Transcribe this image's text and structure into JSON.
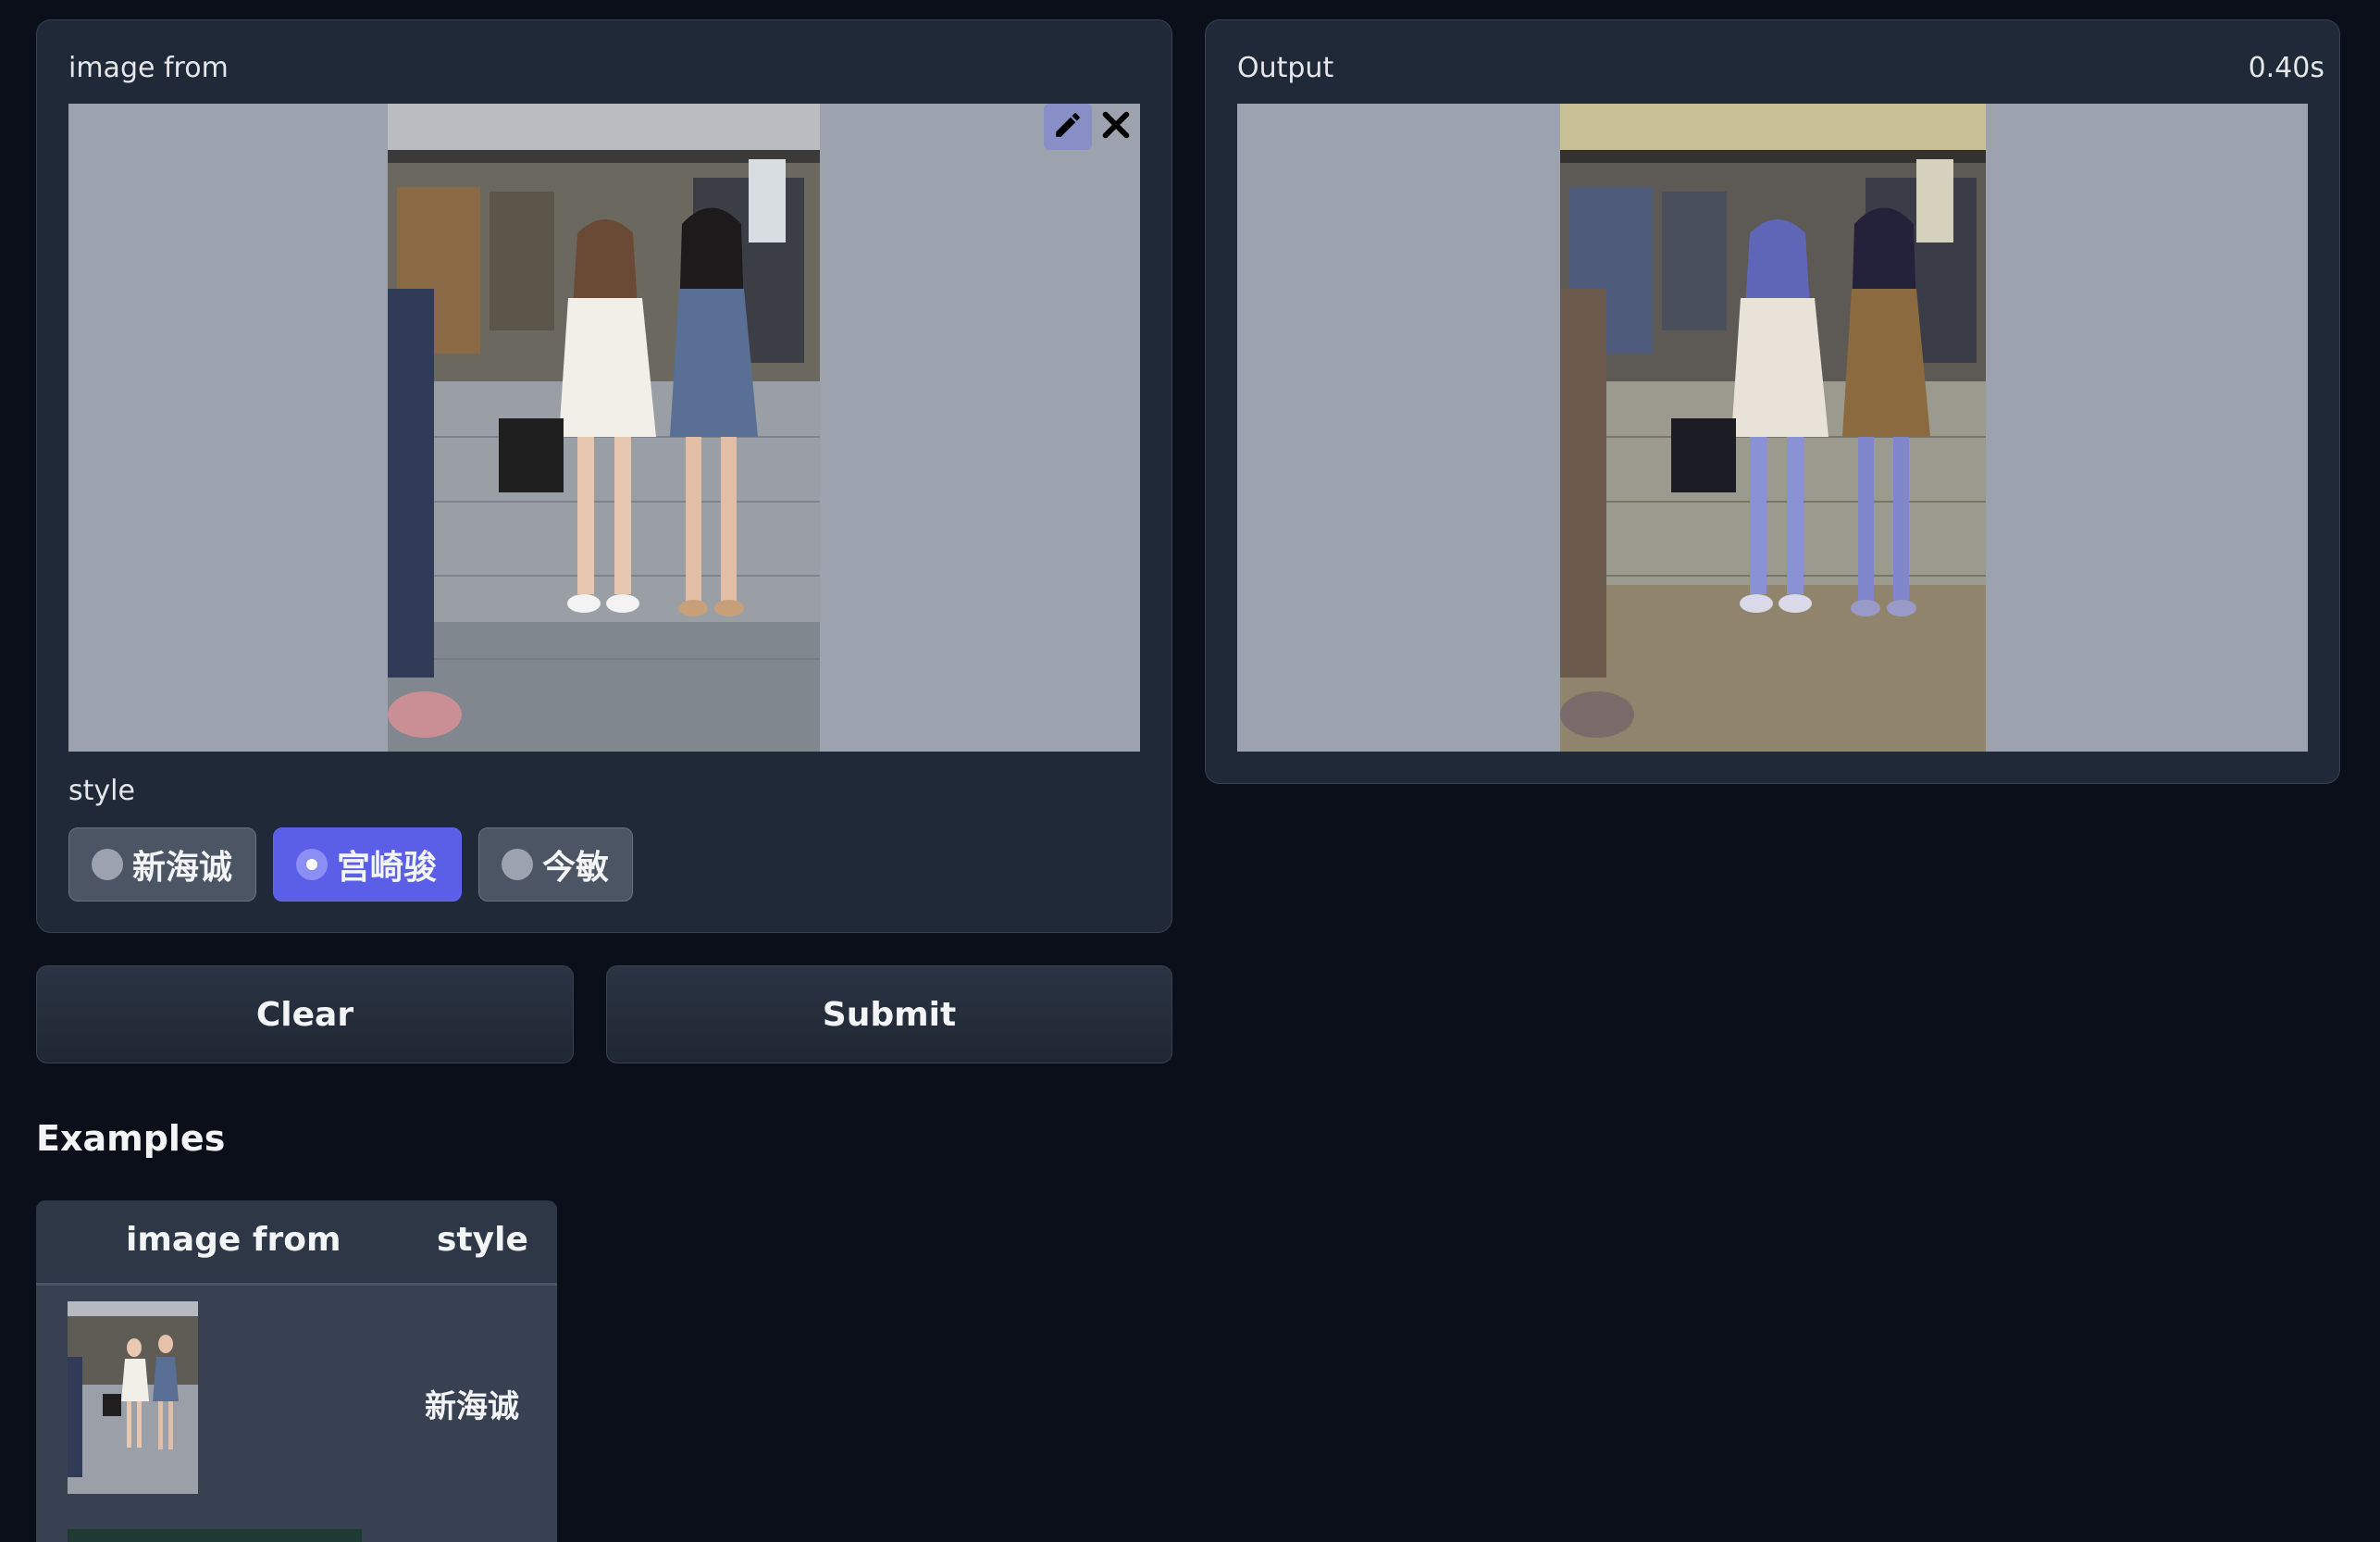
{
  "input": {
    "label": "image from",
    "edit_icon": "pencil-icon",
    "clear_icon": "close-icon"
  },
  "style": {
    "label": "style",
    "options": [
      "新海诚",
      "宫崎骏",
      "今敏"
    ],
    "selected": "宫崎骏"
  },
  "output": {
    "label": "Output",
    "time": "0.40s"
  },
  "buttons": {
    "clear": "Clear",
    "submit": "Submit"
  },
  "examples": {
    "title": "Examples",
    "headers": [
      "image from",
      "style"
    ],
    "rows": [
      {
        "style": "新海诚"
      }
    ]
  },
  "colors": {
    "background": "#0b0f19",
    "panel": "#1f2937",
    "accent": "#5b5fe8",
    "image_placeholder": "#9ca3af"
  }
}
